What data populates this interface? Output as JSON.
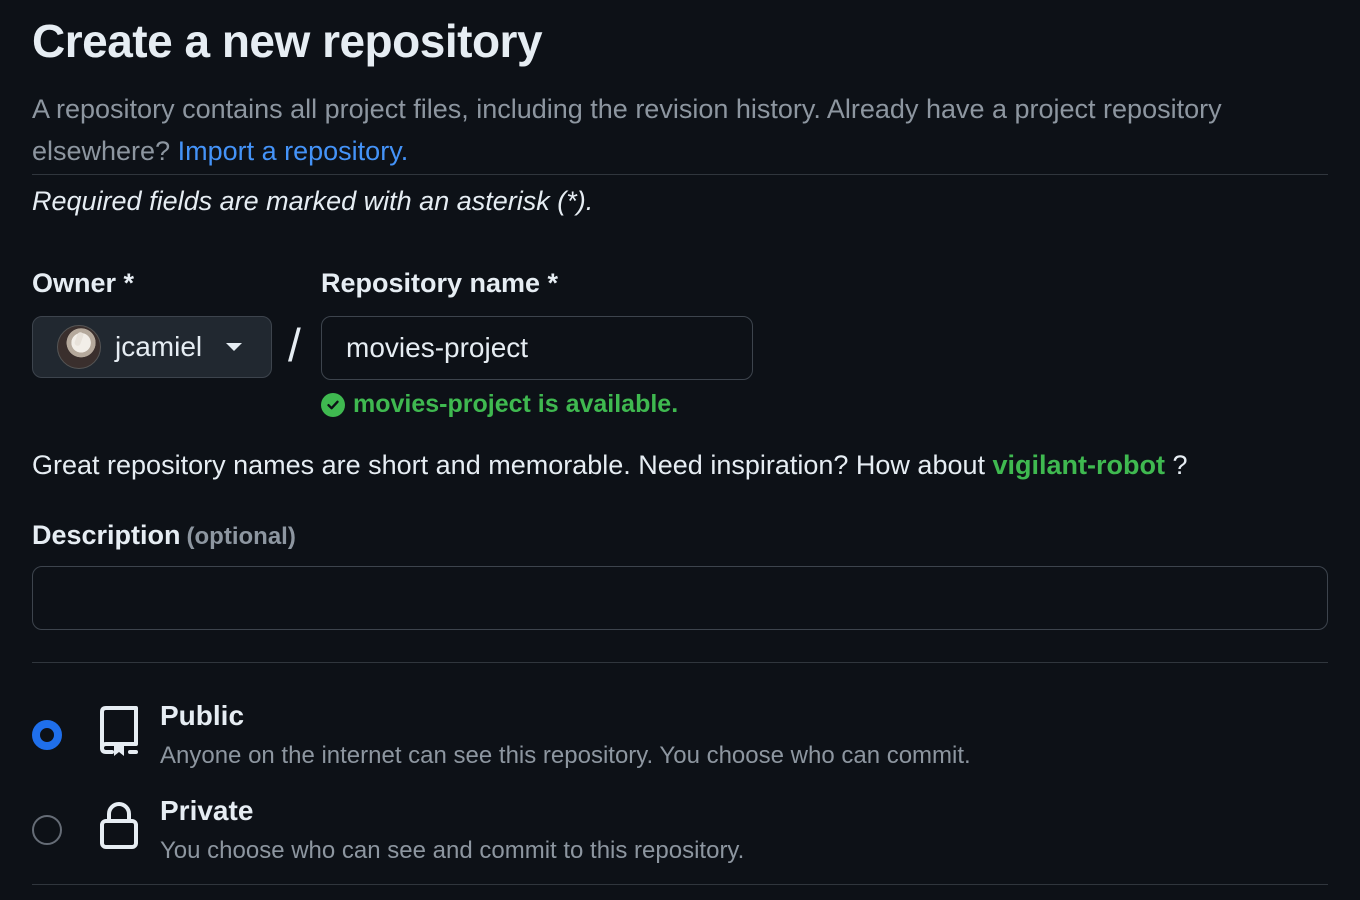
{
  "header": {
    "title": "Create a new repository",
    "subtitle_text": "A repository contains all project files, including the revision history. Already have a project repository elsewhere?",
    "import_link": "Import a repository."
  },
  "required_note": "Required fields are marked with an asterisk (*).",
  "owner": {
    "label": "Owner *",
    "selected": "jcamiel"
  },
  "repo_name": {
    "label": "Repository name *",
    "value": "movies-project",
    "availability": "movies-project is available."
  },
  "inspiration": {
    "text": "Great repository names are short and memorable. Need inspiration? How about",
    "suggestion": "vigilant-robot",
    "suffix": "?"
  },
  "description": {
    "label": "Description",
    "optional": "(optional)",
    "value": ""
  },
  "visibility": {
    "options": [
      {
        "title": "Public",
        "desc": "Anyone on the internet can see this repository. You choose who can commit.",
        "checked": true,
        "icon": "repo-icon"
      },
      {
        "title": "Private",
        "desc": "You choose who can see and commit to this repository.",
        "checked": false,
        "icon": "lock-icon"
      }
    ]
  },
  "colors": {
    "background": "#0d1117",
    "link": "#4493f8",
    "success": "#3fb950",
    "radio_selected": "#1f6feb"
  }
}
